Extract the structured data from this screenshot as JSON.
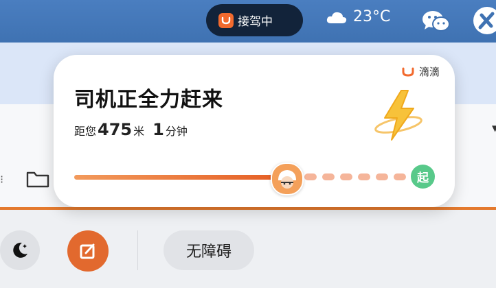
{
  "statusbar": {
    "ride_status": "接驾中",
    "temperature": "23°C",
    "weather_icon": "cloud-icon",
    "chat_icon": "wechat-icon"
  },
  "notification": {
    "brand": "滴滴",
    "title": "司机正全力赶来",
    "distance_prefix": "距您",
    "distance_value": "475",
    "distance_unit": "米",
    "eta_value": "1",
    "eta_unit": "分钟",
    "progress": 0.58,
    "start_label": "起",
    "accent_color": "#e55c22"
  },
  "toolbar": {
    "accessibility_label": "无障碍",
    "moon_icon": "moon-icon",
    "edit_icon": "edit-icon"
  }
}
